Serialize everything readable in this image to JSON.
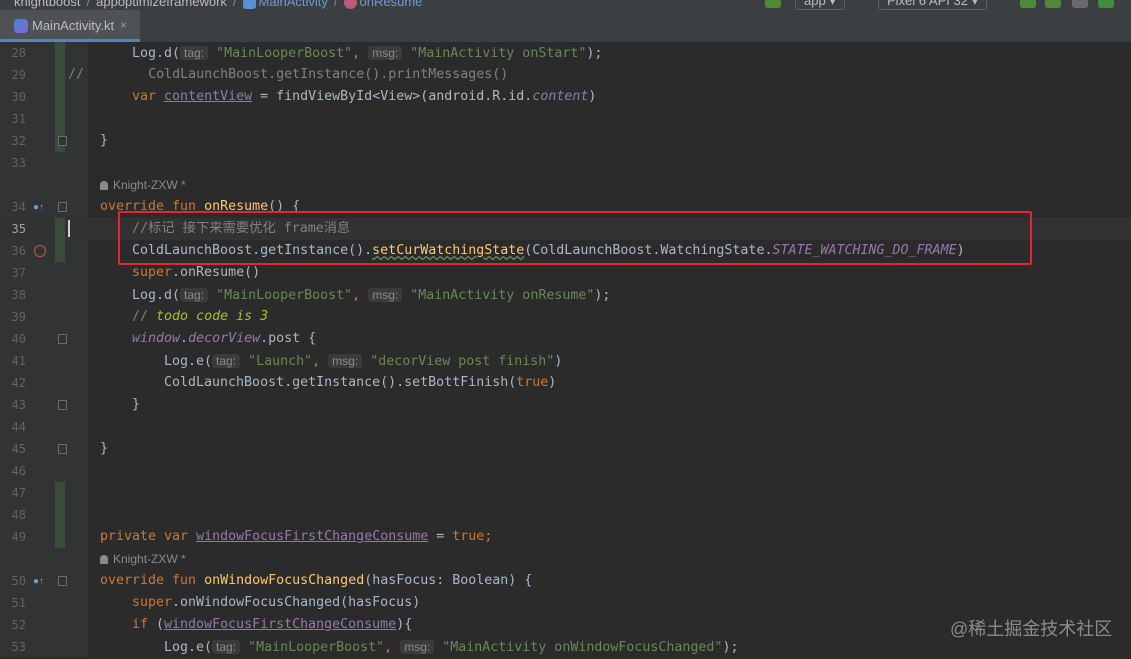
{
  "breadcrumb": {
    "items": [
      "knightboost",
      "appoptimizeframework",
      "MainActivity",
      "onResume"
    ]
  },
  "toolbar": {
    "run_config": "app",
    "device": "Pixel 6 API 32"
  },
  "tab": {
    "label": "MainActivity.kt",
    "close_glyph": "×"
  },
  "line_numbers": [
    "28",
    "29",
    "30",
    "31",
    "32",
    "33",
    "34",
    "35",
    "36",
    "37",
    "38",
    "39",
    "40",
    "41",
    "42",
    "43",
    "44",
    "45",
    "46",
    "47",
    "48",
    "49",
    "50",
    "51",
    "52",
    "53"
  ],
  "author_annotation": "Knight-ZXW *",
  "code": {
    "l28": {
      "a": "Log.d(",
      "hint1": "tag:",
      "s1": "\"MainLooperBoost\"",
      "b": ",",
      "hint2": "msg:",
      "s2": "\"MainActivity onStart\"",
      "c": ");"
    },
    "l29": {
      "prefix": "//",
      "text": "ColdLaunchBoost.getInstance().printMessages()"
    },
    "l30": {
      "kw": "var",
      "name": "contentView",
      "a": " = findViewById<View>(android.R.id.",
      "prop": "content",
      "b": ")"
    },
    "l32": "}",
    "l34": {
      "kw": "override fun",
      "fn": "onResume",
      "a": "() {"
    },
    "l35": {
      "comment": "//标记 接下来需要优化 frame消息"
    },
    "l36": {
      "a": "ColdLaunchBoost.getInstance().",
      "fn": "setCurWatchingState",
      "b": "(ColdLaunchBoost.WatchingState.",
      "prop": "STATE_WATCHING_DO_FRAME",
      "c": ")"
    },
    "l37": {
      "kw": "super",
      "a": ".onResume()"
    },
    "l38": {
      "a": "Log.d(",
      "hint1": "tag:",
      "s1": "\"MainLooperBoost\"",
      "b": ",",
      "hint2": "msg:",
      "s2": "\"MainActivity onResume\"",
      "c": ");"
    },
    "l39": {
      "comment": "// ",
      "todo": "todo code is 3"
    },
    "l40": {
      "prop": "window",
      "a": ".",
      "prop2": "decorView",
      "b": ".post {"
    },
    "l41": {
      "a": "Log.e(",
      "hint1": "tag:",
      "s1": "\"Launch\"",
      "b": ",",
      "hint2": "msg:",
      "s2": "\"decorView post finish\"",
      "c": ")"
    },
    "l42": {
      "a": "ColdLaunchBoost.getInstance().setBottFinish(",
      "kw": "true",
      "b": ")"
    },
    "l43": "}",
    "l45": "}",
    "l49": {
      "kw": "private var",
      "name": "windowFocusFirstChangeConsume",
      "a": " = ",
      "kw2": "true",
      "b": ";"
    },
    "l50": {
      "kw": "override fun",
      "fn": "onWindowFocusChanged",
      "a": "(hasFocus: Boolean) {"
    },
    "l51": {
      "kw": "super",
      "a": ".onWindowFocusChanged(hasFocus)"
    },
    "l52": {
      "kw": "if",
      "a": " (",
      "name": "windowFocusFirstChangeConsume",
      "b": "){"
    },
    "l53": {
      "a": "Log.e(",
      "hint1": "tag:",
      "s1": "\"MainLooperBoost\"",
      "b": ",",
      "hint2": "msg:",
      "s2": "\"MainActivity onWindowFocusChanged\"",
      "c": ");"
    }
  },
  "watermark": "@稀土掘金技术社区",
  "colors": {
    "highlight_box": "#e0282e",
    "keyword": "#cc7832",
    "string": "#6a8759",
    "function": "#ffc66d",
    "property": "#9876aa"
  }
}
